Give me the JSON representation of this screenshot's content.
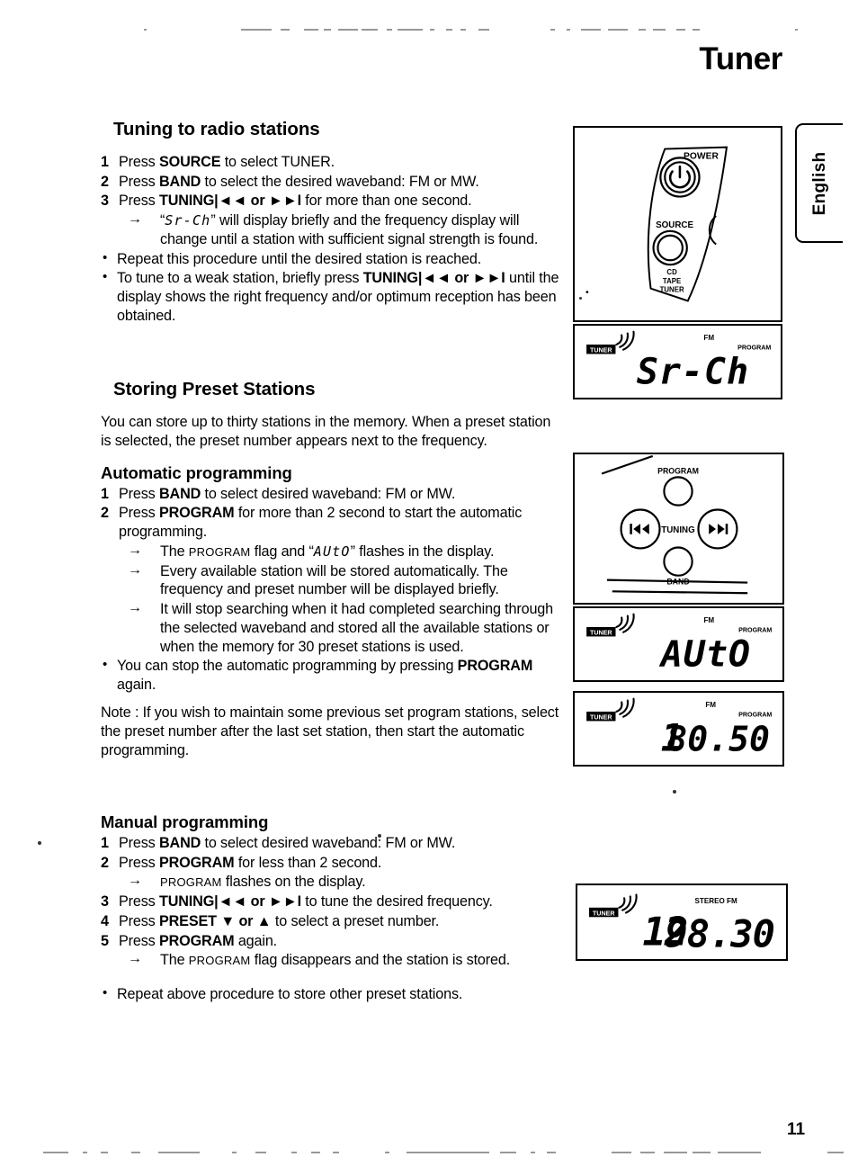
{
  "page": {
    "title": "Tuner",
    "side_tab": "English",
    "number": "11"
  },
  "sections": {
    "tuning": {
      "heading": "Tuning to radio stations",
      "steps": [
        {
          "num": "1",
          "pre": "Press ",
          "bold": "SOURCE",
          "post": " to select TUNER."
        },
        {
          "num": "2",
          "pre": "Press ",
          "bold": "BAND",
          "post": " to select the desired waveband: FM or MW."
        },
        {
          "num": "3",
          "pre": "Press ",
          "bold": "TUNING",
          "icons": "|◄◄  or  ►►I",
          "post": " for more than one second."
        }
      ],
      "arrow_notes": [
        {
          "lcd": "Sr-Ch",
          "text": "will display briefly and the frequency display will change until a station with sufficient signal strength is found."
        }
      ],
      "bullets": [
        {
          "text": "Repeat this procedure until the desired station is reached."
        },
        {
          "pre": "To tune to a weak station, briefly press ",
          "bold": "TUNING",
          "icons": "|◄◄  or  ►►I",
          "post": " until the display shows the right frequency and/or optimum reception has been obtained."
        }
      ]
    },
    "storing": {
      "heading": "Storing Preset Stations",
      "intro": "You can store up to thirty stations in the memory. When a preset station is selected, the preset number appears next to the frequency.",
      "automatic": {
        "heading": "Automatic programming",
        "steps": [
          {
            "num": "1",
            "pre": "Press ",
            "bold": "BAND",
            "post": " to select desired waveband: FM or MW."
          },
          {
            "num": "2",
            "pre": "Press ",
            "bold": "PROGRAM",
            "post": " for more than 2 second to start the automatic programming."
          }
        ],
        "arrow_notes": [
          {
            "pre": "The ",
            "smallcaps": "PROGRAM",
            "mid": " flag and “",
            "lcd": "AUtO",
            "post": "” flashes in the display."
          },
          {
            "text": "Every available station will be stored automatically. The frequency and preset number will be displayed briefly."
          },
          {
            "text": "It will stop searching when it had completed searching through the selected waveband and stored all the available stations or when the memory for 30 preset stations is used."
          }
        ],
        "bullets": [
          {
            "pre": "You can stop the automatic programming by pressing ",
            "bold": "PROGRAM",
            "post": " again."
          }
        ],
        "note": "Note : If you wish to maintain some previous set program stations, select the preset number after the last set station, then start the automatic programming."
      },
      "manual": {
        "heading": "Manual programming",
        "steps": [
          {
            "num": "1",
            "pre": "Press ",
            "bold": "BAND",
            "post": " to select desired waveband: FM or MW."
          },
          {
            "num": "2",
            "pre": "Press ",
            "bold": "PROGRAM",
            "post": " for less than 2 second."
          },
          {
            "num": "3",
            "pre": "Press ",
            "bold": "TUNING",
            "icons": "|◄◄  or  ►►I",
            "post": " to tune the desired frequency."
          },
          {
            "num": "4",
            "pre": "Press ",
            "bold": "PRESET",
            "icons": "▼ or ▲",
            "post": " to select a preset number."
          },
          {
            "num": "5",
            "pre": "Press ",
            "bold": "PROGRAM",
            "post": " again."
          }
        ],
        "arrow_after_step2": {
          "smallcaps": "PROGRAM",
          "post": " flashes on the display."
        },
        "arrow_after_step5": {
          "pre": "The ",
          "smallcaps": "PROGRAM",
          "post": " flag disappears and the station is stored."
        },
        "bullets": [
          {
            "text": "Repeat above procedure to store other preset stations."
          }
        ]
      }
    }
  },
  "figures": {
    "panel_power_source": {
      "power_label": "POWER",
      "source_label": "SOURCE",
      "source_sub_1": "CD",
      "source_sub_2": "TAPE",
      "source_sub_3": "TUNER",
      "power_icon": "power-symbol"
    },
    "panel_tuning": {
      "program_label": "PROGRAM",
      "tuning_label": "TUNING",
      "band_label": "BAND",
      "prev_icon": "skip-back-icon",
      "next_icon": "skip-forward-icon"
    },
    "lcd_srch": {
      "tuner_badge": "TUNER",
      "band_flag": "FM",
      "program_flag": "PROGRAM",
      "preset": "",
      "main": "Sr-Ch"
    },
    "lcd_auto": {
      "tuner_badge": "TUNER",
      "band_flag": "FM",
      "program_flag": "PROGRAM",
      "preset": "",
      "main": "AUtO"
    },
    "lcd_preset1": {
      "tuner_badge": "TUNER",
      "band_flag": "FM",
      "program_flag": "PROGRAM",
      "preset": "1",
      "main": "80.50"
    },
    "lcd_preset12": {
      "tuner_badge": "TUNER",
      "band_flag": "STEREO  FM",
      "program_flag": "",
      "preset": "12",
      "main": "98.30"
    }
  },
  "colors": {
    "ink": "#000000",
    "paper": "#ffffff"
  }
}
